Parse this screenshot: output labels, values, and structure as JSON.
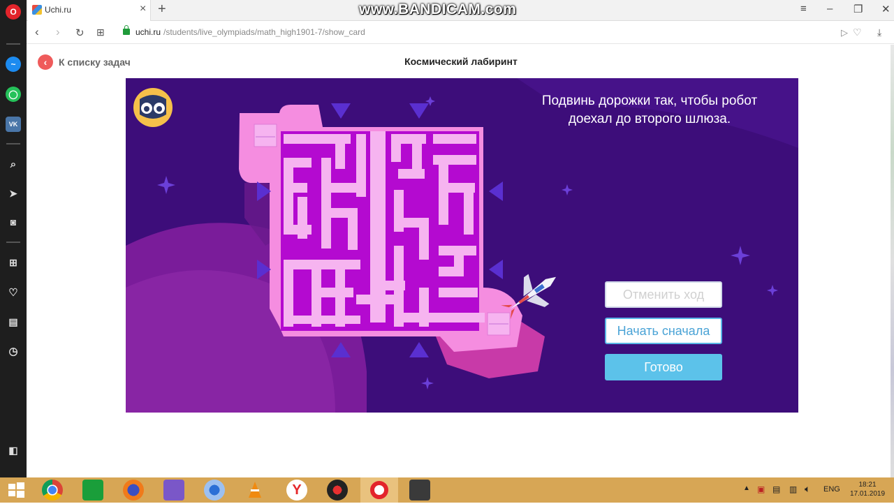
{
  "browser": {
    "tab_title": "Uchi.ru",
    "watermark": "www.BANDICAM.com",
    "url_domain": "uchi.ru",
    "url_path": "/students/live_olympiads/math_high1901-7/show_card"
  },
  "page": {
    "back_label": "К списку задач",
    "title": "Космический лабиринт"
  },
  "game": {
    "instruction_line1": "Подвинь дорожки так, чтобы робот",
    "instruction_line2": "доехал до второго шлюза.",
    "undo_label": "Отменить ход",
    "restart_label": "Начать сначала",
    "done_label": "Готово"
  },
  "colors": {
    "bg_space": "#3d0d7a",
    "board_frame": "#f58de0",
    "path": "#f6b4f0",
    "wall": "#b40ad0",
    "arrow": "#5a2fd0"
  },
  "taskbar": {
    "lang": "ENG",
    "time": "18:21",
    "date": "17.01.2019"
  }
}
